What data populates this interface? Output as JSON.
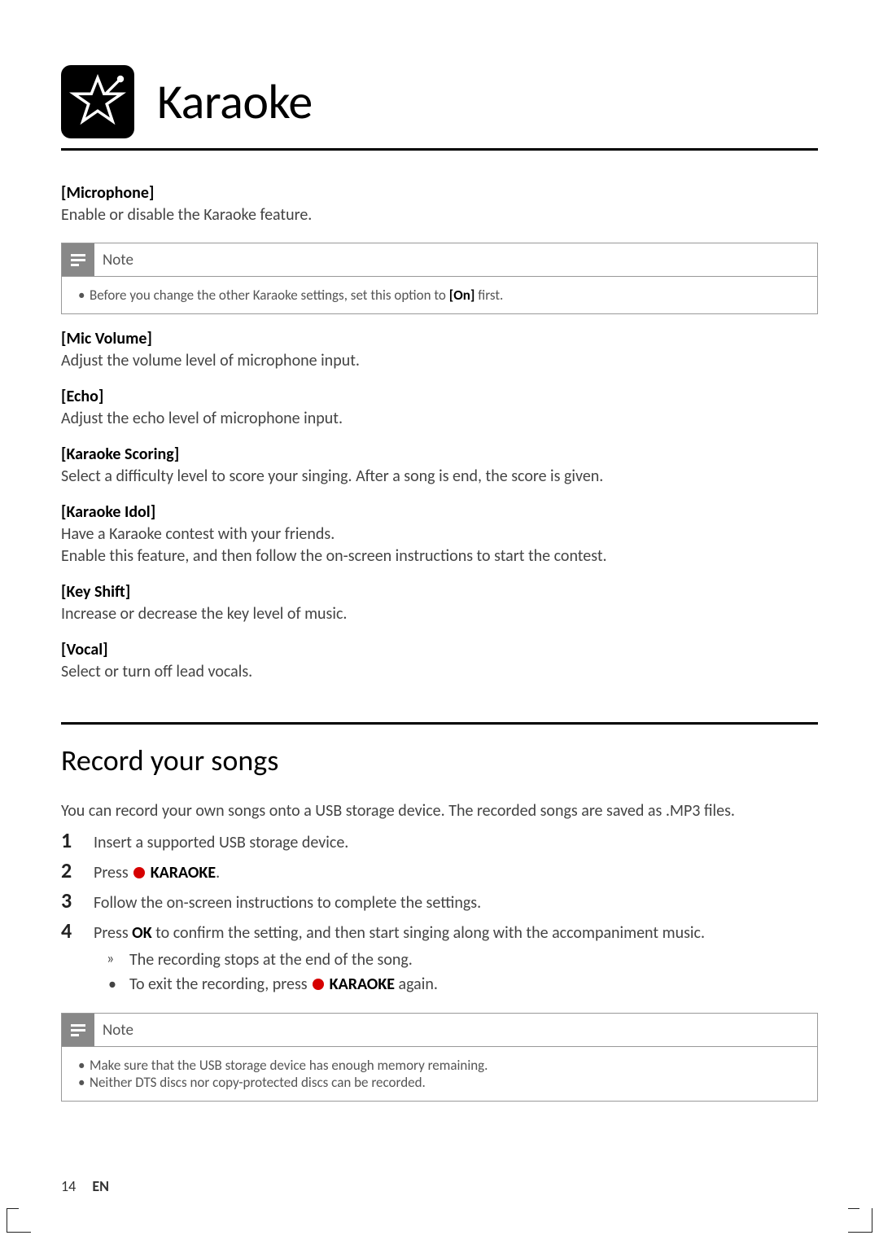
{
  "header": {
    "title": "Karaoke",
    "icon": "karaoke-star-icon"
  },
  "settings": [
    {
      "name": "[Microphone]",
      "desc": "Enable or disable the Karaoke feature."
    }
  ],
  "note1": {
    "label": "Note",
    "bullets": [
      "Before you change the other Karaoke settings, set this option to [On] first."
    ],
    "bold_inline": "[On]"
  },
  "settings2": [
    {
      "name": "[Mic Volume]",
      "desc": "Adjust the volume level of microphone input."
    },
    {
      "name": "[Echo]",
      "desc": "Adjust the echo level of microphone input."
    },
    {
      "name": "[Karaoke Scoring]",
      "desc": "Select a difficulty level to score your singing. After a song is end, the score is given."
    },
    {
      "name": "[Karaoke Idol]",
      "desc": "Have a Karaoke contest with your friends.\nEnable this feature, and then follow the on-screen instructions to start the contest."
    },
    {
      "name": "[Key Shift]",
      "desc": "Increase or decrease the key level of music."
    },
    {
      "name": "[Vocal]",
      "desc": "Select or turn off lead vocals."
    }
  ],
  "section2": {
    "title": "Record your songs",
    "intro": "You can record your own songs onto a USB storage device. The recorded songs are saved as .MP3 files.",
    "steps": {
      "s1": "Insert a supported USB storage device.",
      "s2_prefix": "Press ",
      "s2_label": " KARAOKE",
      "s2_suffix": ".",
      "s3": "Follow the on-screen instructions to complete the settings.",
      "s4_prefix": "Press ",
      "s4_ok": "OK",
      "s4_suffix": " to confirm the setting, and then start singing along with the accompaniment music."
    },
    "sub": {
      "a": "The recording stops at the end of the song.",
      "b_prefix": "To exit the recording, press ",
      "b_label": " KARAOKE",
      "b_suffix": " again."
    }
  },
  "note2": {
    "label": "Note",
    "bullets": [
      "Make sure that the USB storage device has enough memory remaining.",
      "Neither DTS discs nor copy-protected discs can be recorded."
    ]
  },
  "footer": {
    "page": "14",
    "lang": "EN"
  }
}
